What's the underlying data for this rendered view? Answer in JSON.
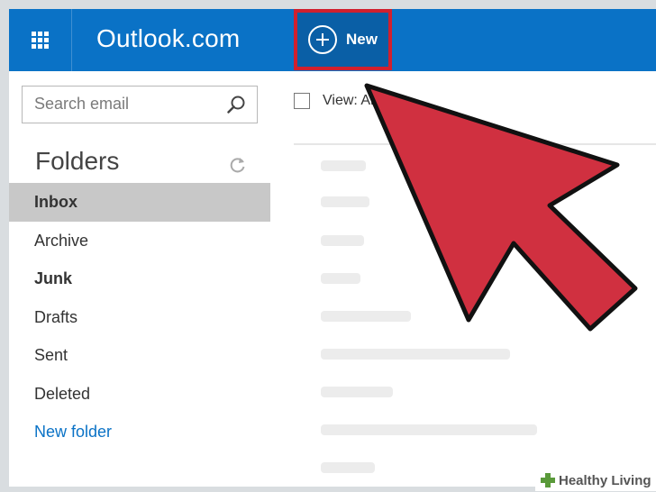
{
  "header": {
    "app_title": "Outlook.com",
    "new_button_label": "New",
    "app_launcher_icon": "waffle-grid-icon",
    "new_icon": "plus-circle-icon",
    "highlight_color": "#d1202e",
    "brand_color": "#0a72c6"
  },
  "search": {
    "placeholder": "Search email",
    "icon": "search-icon"
  },
  "folders": {
    "title": "Folders",
    "refresh_icon": "refresh-icon",
    "items": [
      {
        "label": "Inbox",
        "selected": true
      },
      {
        "label": "Archive"
      },
      {
        "label": "Junk"
      },
      {
        "label": "Drafts"
      },
      {
        "label": "Sent"
      },
      {
        "label": "Deleted"
      },
      {
        "label": "New folder"
      }
    ]
  },
  "message_list": {
    "view_label": "View: All"
  },
  "annotation": {
    "arrow_color": "#d03040",
    "pointer_icon": "arrow-pointer-icon"
  },
  "watermark": {
    "text": "Healthy Living"
  }
}
